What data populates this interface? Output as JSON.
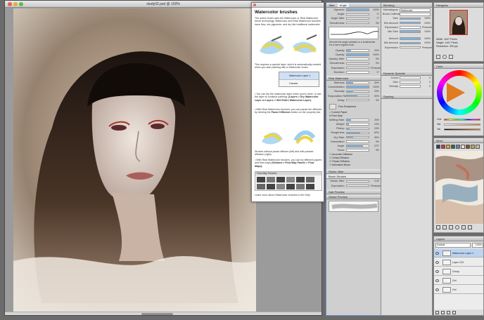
{
  "canvas_window": {
    "title": "study02.psd @ 100%",
    "scroll_position": 0.48
  },
  "help_popup": {
    "title": "Watercolor brushes",
    "intro": "The active brush uses the Watercolor or Real Watercolor brush technology. Watercolor and Real Watercolor brushes have flow, mix pigments, and dry like traditional watercolor.",
    "layer_note": "This requires a special layer, which is automatically created when you start painting with a Watercolor brush.",
    "layer_example": "Watercolor Layer 1",
    "canvas_label": "Canvas",
    "bullet_1_pre": "You can dry the watercolor layer when you're done, or wet the layer to continue painting: ",
    "bullet_1_bold": "(Layers > Dry Watercolor Layer or Layers > Wet Entire Watercolor Layer).",
    "bullet_2_pre": "With Real Watercolor brushes, you can pause the diffusion by clicking the ",
    "bullet_2_bold": "Pause Diffusion",
    "bullet_2_post": " button on the property bar.",
    "caption": "Strokes without pause diffuser (left) and with paused diffusion (right)",
    "bullet_3_pre": "With Real Watercolor brushes, you can try different papers and flow maps ",
    "bullet_3_bold": "(Window > Flow Map Panels > Flow Maps).",
    "flow_maps_label": "Flow Map Textures",
    "learn_more": "Learn more about Watercolor brushes in the Help."
  },
  "panel_b": {
    "tab_1": "Jitter",
    "tab_2": "Angle",
    "rows": [
      {
        "label": "Squeeze",
        "val": "100%",
        "fill": 1.0
      },
      {
        "label": "Angle",
        "val": "0°",
        "fill": 0.0
      },
      {
        "label": "Angle Jitter",
        "val": "0°",
        "fill": 0.0
      },
      {
        "label": "Smoothness",
        "val": "0%",
        "fill": 0.0
      }
    ],
    "smooth_caption": "Smooth the angle variation in a brushstroke for a more organic look.",
    "rows_2": [
      {
        "label": "Opacity",
        "val": "20%",
        "fill": 0.2
      },
      {
        "label": "Opacity",
        "val": "100%",
        "fill": 1.0
      },
      {
        "label": "Opacity Jitter",
        "val": "0%",
        "fill": 0.0
      },
      {
        "label": "Smoothness",
        "val": "0%",
        "fill": 0.0
      },
      {
        "label": "Expression",
        "val": "Pressure",
        "fill": 0.0
      },
      {
        "label": "Direction",
        "val": "0°",
        "fill": 0.0
      }
    ],
    "section_real_wc": "Real Watercolor",
    "wetness_rows": [
      {
        "label": "Wetness",
        "val": "30%",
        "fill": 0.3
      },
      {
        "label": "Concentration",
        "val": "100%",
        "fill": 1.0
      },
      {
        "label": "Viscosity",
        "val": "29%",
        "fill": 0.29
      },
      {
        "label": "Evaporation Rate",
        "val": "50%",
        "fill": 0.5
      },
      {
        "label": "Delay",
        "val": "0%",
        "fill": 0.0
      }
    ],
    "paper_label": "Fine Reclaimed",
    "paper_texture": "Current Paper",
    "flow_map": "Flow Map",
    "pigment_rows": [
      {
        "label": "Settling Rate",
        "val": "20%",
        "fill": 0.2
      },
      {
        "label": "Weight",
        "val": "10%",
        "fill": 0.1
      },
      {
        "label": "Pickup",
        "val": "15%",
        "fill": 0.15
      }
    ],
    "paper_rows": [
      {
        "label": "Roughness",
        "val": "62%",
        "fill": 0.62
      },
      {
        "label": "Dry Rate",
        "val": "30%",
        "fill": 0.3
      },
      {
        "label": "Granulation",
        "val": "0%",
        "fill": 0.0
      }
    ],
    "wind_rows": [
      {
        "label": "Angle",
        "val": "270°",
        "fill": 0.75
      },
      {
        "label": "Force",
        "val": "0%",
        "fill": 0.0
      }
    ],
    "checks": [
      "Accurate Diffusion",
      "Delay Diffusion",
      "Pause Diffusion",
      "Activation Boost"
    ],
    "section_stroke": "Stroke Jitter",
    "tab_brush_strokes": "Brush Strokes",
    "stroke_rows": [
      {
        "label": "Stroke Jitter",
        "val": "0.00",
        "fill": 0.0
      },
      {
        "label": "Expression",
        "val": "Pressure",
        "fill": 0.0
      }
    ],
    "section_dab": "Dab Preview",
    "section_stroke_preview": "Stroke Preview"
  },
  "panel_c": {
    "tab": "Blending",
    "top_rows": [
      {
        "label": "Subcategory",
        "val": "Watercolor"
      },
      {
        "label": "Brush Calibration",
        "val": ""
      }
    ],
    "rows_a": [
      {
        "label": "Size",
        "val": "100%",
        "fill": 1.0
      },
      {
        "label": "Min Amount",
        "val": "100%",
        "fill": 1.0
      },
      {
        "label": "Expression",
        "val": "Pressure",
        "fill": 0.0
      },
      {
        "label": "Min Size",
        "val": "100%",
        "fill": 1.0
      }
    ],
    "rows_b": [
      {
        "label": "Amount",
        "val": "100%",
        "fill": 1.0
      },
      {
        "label": "Min Amount",
        "val": "100%",
        "fill": 1.0
      },
      {
        "label": "Expression",
        "val": "Pressure",
        "fill": 0.0
      }
    ],
    "section_2": "Dynamic Speckle",
    "section_3": "Spacing",
    "rows_c": [
      {
        "label": "Count",
        "val": "0",
        "fill": 0.0
      },
      {
        "label": "Size",
        "val": "0",
        "fill": 0.0
      },
      {
        "label": "Density",
        "val": "0",
        "fill": 0.0
      }
    ]
  },
  "navigator": {
    "tab": "Navigator",
    "width_label": "Width:",
    "width_val": "1047 Pixels",
    "height_label": "Height:",
    "height_val": "1447 Pixels",
    "res_label": "Resolution:",
    "res_val": "300 ppi"
  },
  "color": {
    "tab": "Color",
    "hue": "Hue",
    "sat": "Sat",
    "val": "Val"
  },
  "mixer": {
    "tab": "Mixer",
    "swatch_colors": [
      "#3b3d6f",
      "#c23a2e",
      "#e1a23a",
      "#2e6b3a",
      "#6f7fb5",
      "#e6e0d2",
      "#8c4c2b",
      "#a8b04e",
      "#d9b8a0"
    ]
  },
  "layers": {
    "tab": "Layers",
    "composite": "Default",
    "opacity": "100%",
    "items": [
      {
        "name": "Watercolor Layer 1",
        "selected": true
      },
      {
        "name": "Layer 123",
        "selected": false
      },
      {
        "name": "Group",
        "selected": false
      },
      {
        "name": "Girl",
        "selected": false
      },
      {
        "name": "Girl",
        "selected": false
      }
    ]
  }
}
